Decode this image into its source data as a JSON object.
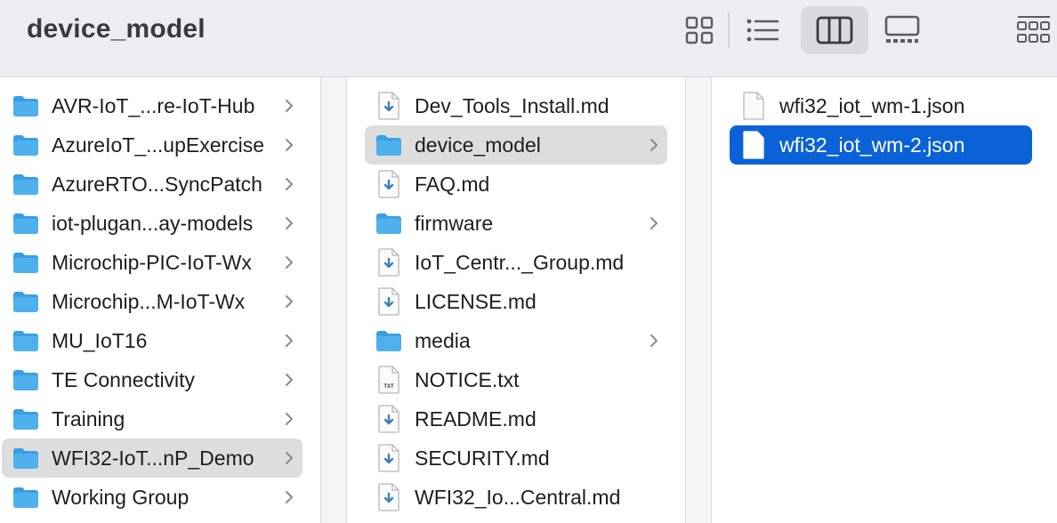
{
  "window": {
    "title": "device_model"
  },
  "toolbar": {
    "views": [
      {
        "name": "icon-view",
        "icon": "grid-icon",
        "active": false
      },
      {
        "name": "list-view",
        "icon": "list-icon",
        "active": false
      },
      {
        "name": "column-view",
        "icon": "columns-icon",
        "active": true
      },
      {
        "name": "gallery-view",
        "icon": "gallery-icon",
        "active": false
      },
      {
        "name": "group-view",
        "icon": "group-icon",
        "active": false
      }
    ]
  },
  "columns": [
    {
      "items": [
        {
          "label": "AVR-IoT_...re-IoT-Hub",
          "kind": "folder",
          "chevron": true
        },
        {
          "label": "AzureIoT_...upExercise",
          "kind": "folder",
          "chevron": true
        },
        {
          "label": "AzureRTO...SyncPatch",
          "kind": "folder",
          "chevron": true
        },
        {
          "label": "iot-plugan...ay-models",
          "kind": "folder",
          "chevron": true
        },
        {
          "label": "Microchip-PIC-IoT-Wx",
          "kind": "folder",
          "chevron": true
        },
        {
          "label": "Microchip...M-IoT-Wx",
          "kind": "folder",
          "chevron": true
        },
        {
          "label": "MU_IoT16",
          "kind": "folder",
          "chevron": true
        },
        {
          "label": "TE Connectivity",
          "kind": "folder",
          "chevron": true
        },
        {
          "label": "Training",
          "kind": "folder",
          "chevron": true
        },
        {
          "label": "WFI32-IoT...nP_Demo",
          "kind": "folder",
          "chevron": true,
          "state": "highlighted"
        },
        {
          "label": "Working Group",
          "kind": "folder",
          "chevron": true
        }
      ]
    },
    {
      "items": [
        {
          "label": "Dev_Tools_Install.md",
          "kind": "md",
          "chevron": false
        },
        {
          "label": "device_model",
          "kind": "folder",
          "chevron": true,
          "state": "highlighted"
        },
        {
          "label": "FAQ.md",
          "kind": "md",
          "chevron": false
        },
        {
          "label": "firmware",
          "kind": "folder",
          "chevron": true
        },
        {
          "label": "IoT_Centr..._Group.md",
          "kind": "md",
          "chevron": false
        },
        {
          "label": "LICENSE.md",
          "kind": "md",
          "chevron": false
        },
        {
          "label": "media",
          "kind": "folder",
          "chevron": true
        },
        {
          "label": "NOTICE.txt",
          "kind": "txt",
          "chevron": false,
          "badge": "TXT"
        },
        {
          "label": "README.md",
          "kind": "md",
          "chevron": false
        },
        {
          "label": "SECURITY.md",
          "kind": "md",
          "chevron": false
        },
        {
          "label": "WFI32_Io...Central.md",
          "kind": "md",
          "chevron": false
        }
      ]
    },
    {
      "items": [
        {
          "label": "wfi32_iot_wm-1.json",
          "kind": "doc",
          "chevron": false
        },
        {
          "label": "wfi32_iot_wm-2.json",
          "kind": "doc",
          "chevron": false,
          "state": "selected"
        }
      ]
    }
  ],
  "colors": {
    "toolbar_bg": "#efebf3",
    "selection": "#0a62d6",
    "highlight": "#dddddd",
    "folder": "#4fb0ee",
    "md_arrow": "#3d7fb8"
  }
}
